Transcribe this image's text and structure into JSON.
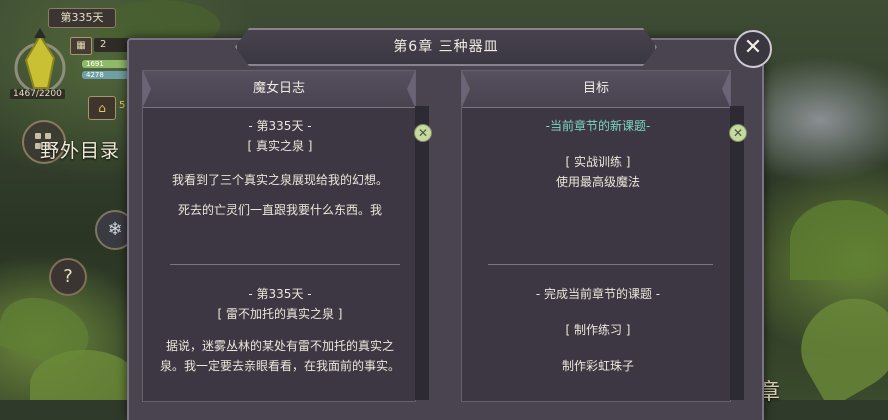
{
  "hud": {
    "day_badge": "第335天",
    "hp": "1467/2200",
    "resource_count": "2",
    "bar1_text": "1691",
    "bar2_text": "4278",
    "small_value": "5",
    "wild_label": "野外目录",
    "help_glyph": "?",
    "gear_glyph": "❄",
    "house_glyph": "⌂",
    "right_edge_glyph": "章"
  },
  "modal": {
    "title": "第6章  三种器皿",
    "close_glyph": "✕",
    "left_column": {
      "header": "魔女日志",
      "entries": [
        {
          "day": "- 第335天 -",
          "topic": "[ 真实之泉 ]",
          "body": "我看到了三个真实之泉展现给我的幻想。",
          "body2": "死去的亡灵们一直跟我要什么东西。我"
        },
        {
          "day": "- 第335天 -",
          "topic": "[ 雷不加托的真实之泉 ]",
          "body": "据说，迷雾丛林的某处有雷不加托的真实之泉。我一定要去亲眼看看，在我面前的事实。"
        }
      ]
    },
    "right_column": {
      "header": "目标",
      "sections": [
        {
          "heading": "-当前章节的新课题-",
          "task": "[ 实战训练 ]",
          "desc": "使用最高级魔法"
        },
        {
          "heading": "- 完成当前章节的课题 -",
          "task": "[ 制作练习 ]",
          "desc": "制作彩虹珠子"
        }
      ]
    },
    "scroll_glyph": "✕"
  },
  "colors": {
    "accent_teal": "#7fd6c3",
    "panel": "#3c3742",
    "scroll_knob": "#c6d9a1"
  }
}
